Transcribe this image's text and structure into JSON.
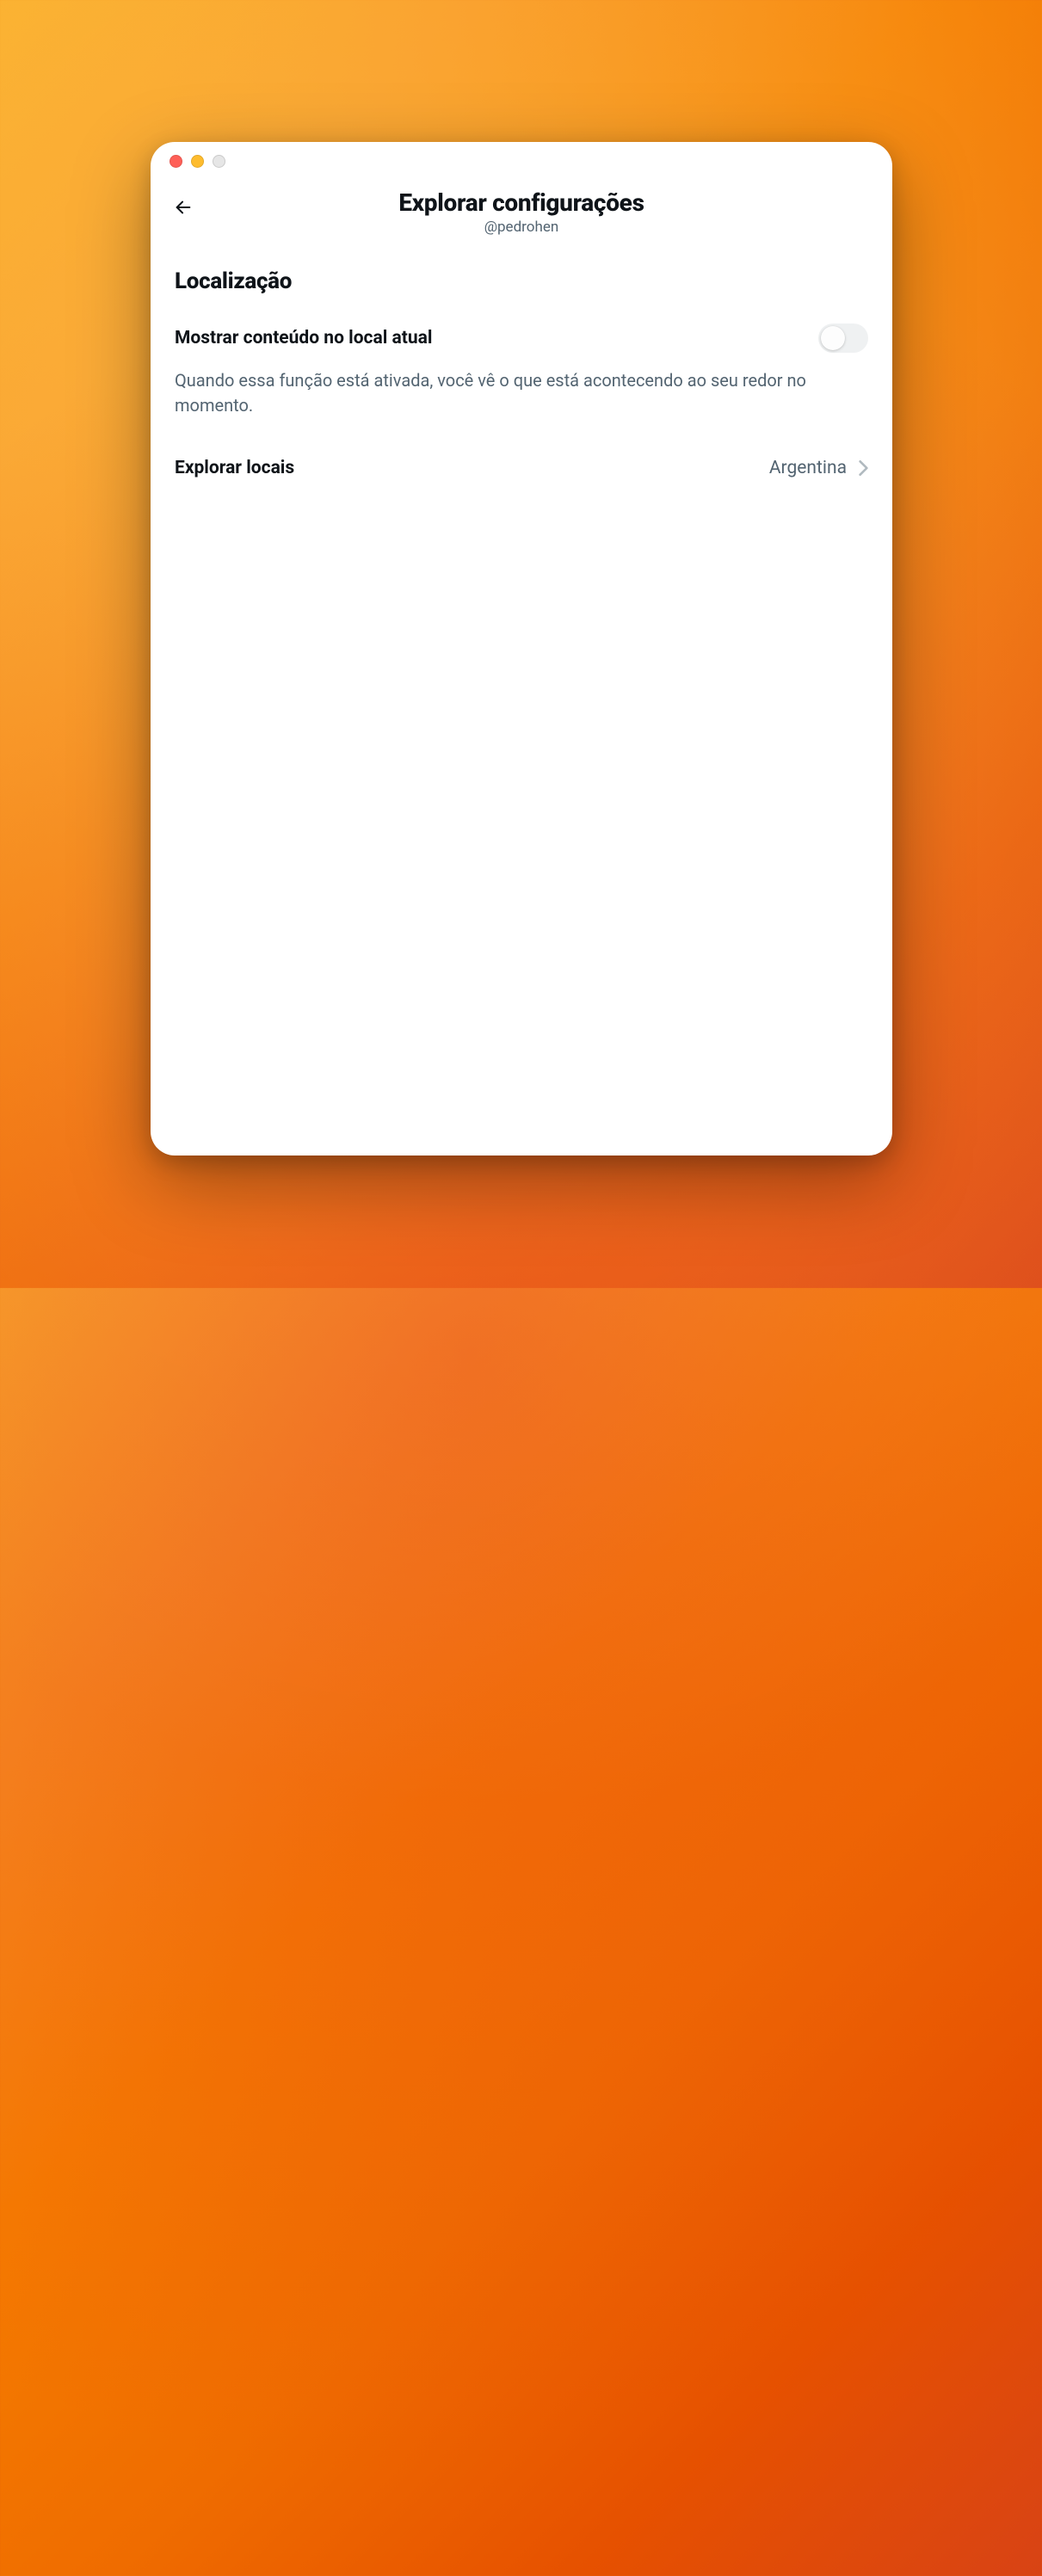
{
  "header": {
    "title": "Explorar configurações",
    "subtitle": "@pedrohen"
  },
  "section": {
    "title": "Localização"
  },
  "settings": {
    "show_local_content": {
      "label": "Mostrar conteúdo no local atual",
      "description": "Quando essa função está ativada, você vê o que está acontecendo ao seu redor no momento.",
      "enabled": false
    },
    "explore_locations": {
      "label": "Explorar locais",
      "value": "Argentina"
    }
  }
}
